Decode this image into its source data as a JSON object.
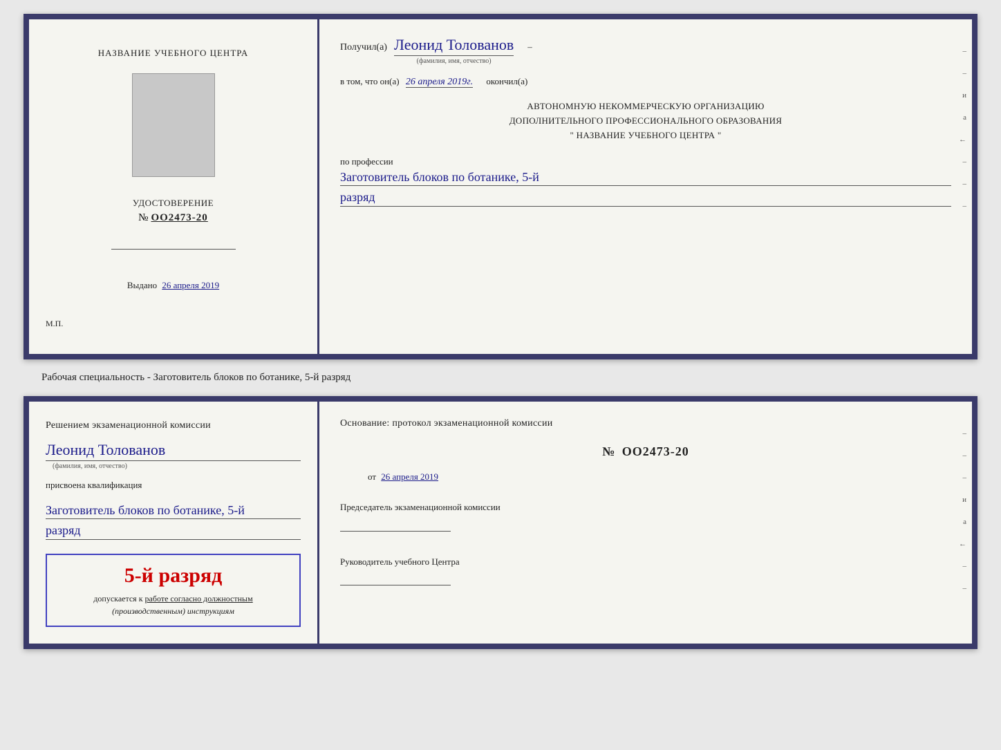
{
  "cert1": {
    "left": {
      "institution_label": "НАЗВАНИЕ УЧЕБНОГО ЦЕНТРА",
      "doc_type": "УДОСТОВЕРЕНИЕ",
      "doc_number_prefix": "№",
      "doc_number": "OO2473-20",
      "issued_label": "Выдано",
      "issued_date": "26 апреля 2019",
      "mp_label": "М.П."
    },
    "right": {
      "received_prefix": "Получил(а)",
      "recipient_name": "Леонид Толованов",
      "name_subtitle": "(фамилия, имя, отчество)",
      "confirm_prefix": "в том, что он(а)",
      "confirm_date": "26 апреля 2019г.",
      "confirm_suffix": "окончил(а)",
      "org_line1": "АВТОНОМНУЮ НЕКОММЕРЧЕСКУЮ ОРГАНИЗАЦИЮ",
      "org_line2": "ДОПОЛНИТЕЛЬНОГО ПРОФЕССИОНАЛЬНОГО ОБРАЗОВАНИЯ",
      "org_line3": "\"   НАЗВАНИЕ УЧЕБНОГО ЦЕНТРА   \"",
      "profession_label": "по профессии",
      "profession_value": "Заготовитель блоков по ботанике, 5-й",
      "rank_value": "разряд"
    }
  },
  "separator": {
    "text": "Рабочая специальность - Заготовитель блоков по ботанике, 5-й разряд"
  },
  "cert2": {
    "left": {
      "decision_line1": "Решением экзаменационной комиссии",
      "recipient_name": "Леонид Толованов",
      "name_subtitle": "(фамилия, имя, отчество)",
      "qualification_label": "присвоена квалификация",
      "profession_value": "Заготовитель блоков по ботанике, 5-й",
      "rank_value": "разряд",
      "stamp_rank": "5-й разряд",
      "stamp_footer1": "допускается к",
      "stamp_footer2": "работе согласно должностным",
      "stamp_footer3": "(производственным) инструкциям"
    },
    "right": {
      "basis_label": "Основание: протокол экзаменационной комиссии",
      "number_prefix": "№",
      "number_value": "OO2473-20",
      "date_prefix": "от",
      "date_value": "26 апреля 2019",
      "chairman_title": "Председатель экзаменационной комиссии",
      "director_title": "Руководитель учебного Центра"
    }
  }
}
